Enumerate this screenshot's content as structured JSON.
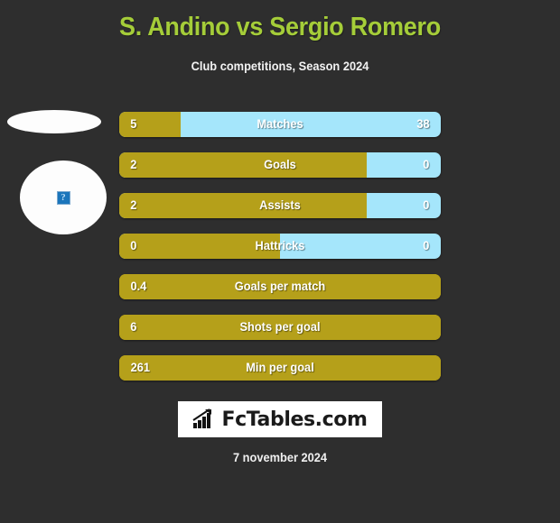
{
  "header": {
    "title": "S. Andino vs Sergio Romero",
    "subtitle": "Club competitions, Season 2024",
    "title_color": "#a5cd39"
  },
  "colors": {
    "background": "#2e2e2e",
    "home_bar": "#b5a01a",
    "away_bar": "#a5e6fb",
    "text": "#ffffff"
  },
  "media": {
    "left_flag": {
      "icon": "broken-image-icon",
      "shape": "ellipse"
    },
    "left_crest": {
      "icon": "broken-image-icon",
      "shape": "circle",
      "glyph": "?"
    },
    "right_crest_a": {
      "icon": "broken-image-icon",
      "shape": "circle",
      "glyph": "?"
    },
    "right_crest_b": {
      "icon": "broken-image-icon",
      "shape": "circle",
      "glyph": "?"
    }
  },
  "chart_data": {
    "type": "bar",
    "title": "S. Andino vs Sergio Romero",
    "subtitle": "Club competitions, Season 2024",
    "orientation": "horizontal-diverging",
    "categories": [
      "Matches",
      "Goals",
      "Assists",
      "Hattricks",
      "Goals per match",
      "Shots per goal",
      "Min per goal"
    ],
    "series": [
      {
        "name": "S. Andino",
        "values": [
          "5",
          "2",
          "2",
          "0",
          "0.4",
          "6",
          "261"
        ]
      },
      {
        "name": "Sergio Romero",
        "values": [
          "38",
          "0",
          "0",
          "0",
          "",
          "",
          ""
        ]
      }
    ],
    "rows": [
      {
        "label": "Matches",
        "home": "5",
        "away": "38",
        "home_pct": 19,
        "split": true
      },
      {
        "label": "Goals",
        "home": "2",
        "away": "0",
        "home_pct": 77,
        "split": true
      },
      {
        "label": "Assists",
        "home": "2",
        "away": "0",
        "home_pct": 77,
        "split": true
      },
      {
        "label": "Hattricks",
        "home": "0",
        "away": "0",
        "home_pct": 50,
        "split": true
      },
      {
        "label": "Goals per match",
        "home": "0.4",
        "away": "",
        "home_pct": 100,
        "split": false
      },
      {
        "label": "Shots per goal",
        "home": "6",
        "away": "",
        "home_pct": 100,
        "split": false
      },
      {
        "label": "Min per goal",
        "home": "261",
        "away": "",
        "home_pct": 100,
        "split": false
      }
    ]
  },
  "footer": {
    "logo_text": "FcTables.com",
    "logo_icon": "bar-chart-growth-icon",
    "date": "7 november 2024"
  }
}
